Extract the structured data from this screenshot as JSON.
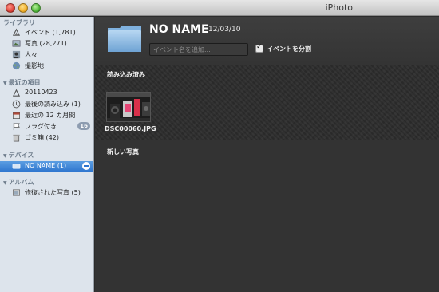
{
  "window": {
    "title": "iPhoto"
  },
  "sidebar": {
    "library": {
      "header": "ライブラリ",
      "items": [
        {
          "label": "イベント (1,781)",
          "icon": "events-icon"
        },
        {
          "label": "写真 (28,271)",
          "icon": "photos-icon"
        },
        {
          "label": "人々",
          "icon": "faces-icon"
        },
        {
          "label": "撮影地",
          "icon": "places-icon"
        }
      ]
    },
    "recent": {
      "header": "最近の項目",
      "items": [
        {
          "label": "20110423",
          "icon": "event-icon"
        },
        {
          "label": "最後の読み込み (1)",
          "icon": "last-import-icon"
        },
        {
          "label": "最近の 12 カ月間",
          "icon": "last-12-months-icon"
        },
        {
          "label": "フラグ付き",
          "icon": "flag-icon",
          "badge": "16"
        },
        {
          "label": "ゴミ箱 (42)",
          "icon": "trash-icon"
        }
      ]
    },
    "devices": {
      "header": "デバイス",
      "items": [
        {
          "label": "NO NAME (1)",
          "icon": "device-icon"
        }
      ]
    },
    "albums": {
      "header": "アルバム",
      "items": [
        {
          "label": "修復された写真 (5)",
          "icon": "album-icon"
        }
      ]
    }
  },
  "main": {
    "event_name": "NO NAME",
    "event_date": "12/03/10",
    "event_input_placeholder": "イベント名を追加...",
    "split_events_label": "イベントを分割",
    "split_events_checked": true,
    "imported_title": "読み込み済み",
    "imported_photos": [
      {
        "filename": "DSC00060.JPG"
      }
    ],
    "new_photos_title": "新しい写真"
  },
  "colors": {
    "sidebar_bg": "#dde4ec",
    "sidebar_header": "#6f7d8c",
    "selection": "#2f76cf",
    "main_bg": "#323232"
  }
}
